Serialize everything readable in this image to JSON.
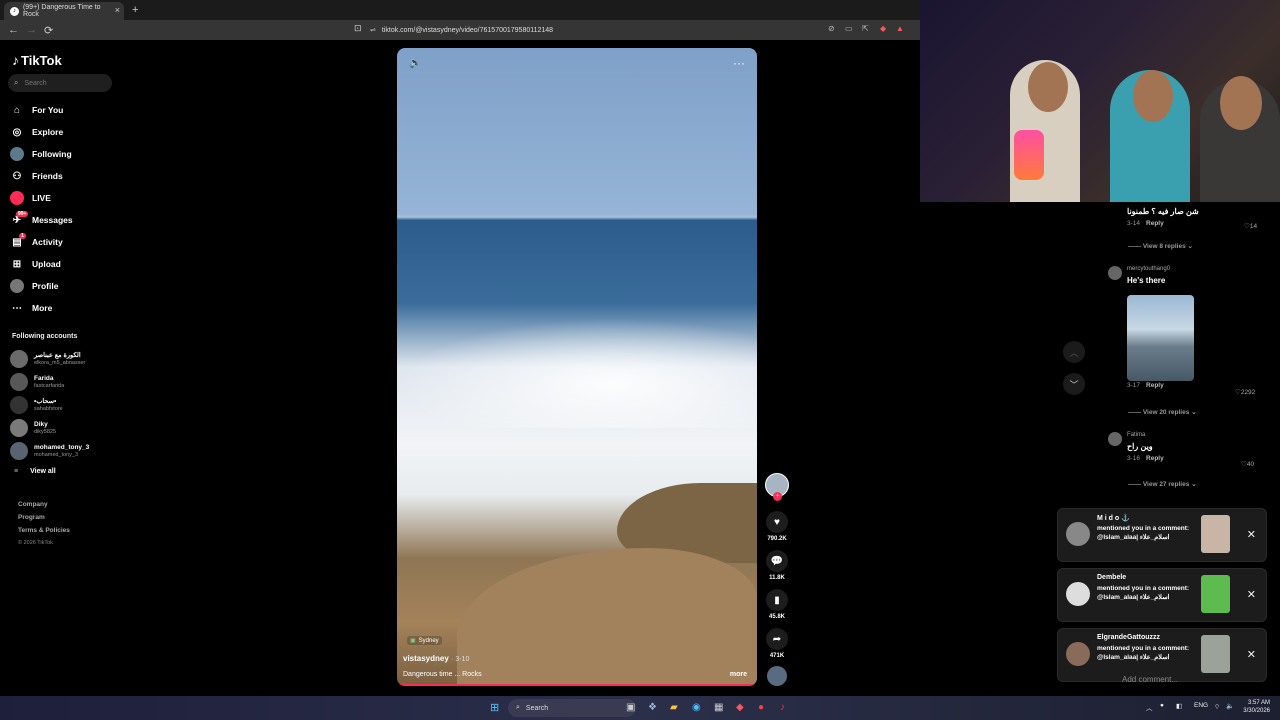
{
  "browser": {
    "tab_title": "(99+) Dangerous Time to Rock",
    "url": "tiktok.com/@vistasydney/video/7615700179580112148",
    "new_tab": "+",
    "close": "×"
  },
  "sidebar": {
    "logo": "TikTok",
    "search_placeholder": "Search",
    "nav": [
      {
        "label": "For You",
        "icon": "home-icon"
      },
      {
        "label": "Explore",
        "icon": "compass-icon"
      },
      {
        "label": "Following",
        "icon": "avatar"
      },
      {
        "label": "Friends",
        "icon": "friends-icon"
      },
      {
        "label": "LIVE",
        "icon": "live-icon"
      },
      {
        "label": "Messages",
        "icon": "message-icon",
        "badge": "99+"
      },
      {
        "label": "Activity",
        "icon": "inbox-icon",
        "badge": "1"
      },
      {
        "label": "Upload",
        "icon": "upload-icon"
      },
      {
        "label": "Profile",
        "icon": "profile-icon"
      },
      {
        "label": "More",
        "icon": "more-icon"
      }
    ],
    "following_title": "Following accounts",
    "accounts": [
      {
        "name": "الكورة مع عبناصر",
        "handle": "elkora_m5_abnasser"
      },
      {
        "name": "Farida",
        "handle": "fastcarfarida"
      },
      {
        "name": "•سحاب•",
        "handle": "sahabfstore"
      },
      {
        "name": "Diky",
        "handle": "diky5825"
      },
      {
        "name": "mohamed_tony_3",
        "handle": "mohamed_tony_3"
      }
    ],
    "view_all": "View all",
    "footer": [
      "Company",
      "Program",
      "Terms & Policies"
    ],
    "copyright": "© 2026 TikTok"
  },
  "video": {
    "location": "Sydney",
    "author": "vistasydney",
    "date": "· 3-10",
    "description": "Dangerous time ... Rocks",
    "more": "more",
    "progress": 1.0
  },
  "actions": {
    "likes": "790.2K",
    "comments": "11.8K",
    "saves": "45.8K",
    "shares": "471K"
  },
  "comments": [
    {
      "text": "شن صار فيه ؟ طمنونا",
      "date": "3-14",
      "reply": "Reply",
      "likes": "14",
      "view_replies": "View 8 replies"
    },
    {
      "user": "mercytouthang0",
      "text": "He's there",
      "date": "3-17",
      "reply": "Reply",
      "likes": "2292",
      "view_replies": "View 20 replies"
    },
    {
      "user": "Fatima",
      "text": "وين راح",
      "date": "3-16",
      "reply": "Reply",
      "likes": "40",
      "view_replies": "View 27 replies"
    }
  ],
  "notifications": [
    {
      "who": "M i d o ⚓",
      "msg": "mentioned you in a comment: @Islam_alaa| اسلام_علاء"
    },
    {
      "who": "Dembele",
      "msg": "mentioned you in a comment: @Islam_alaa| اسلام_علاء"
    },
    {
      "who": "ElgrandeGattouzzz",
      "msg": "mentioned you in a comment: @Islam_alaa| اسلام_علاء"
    }
  ],
  "add_comment": "Add comment...",
  "taskbar": {
    "search": "Search",
    "lang": "ENG",
    "time": "3:57 AM",
    "date": "3/30/2026"
  },
  "colors": {
    "accent": "#fe2c55",
    "bg": "#000000"
  }
}
